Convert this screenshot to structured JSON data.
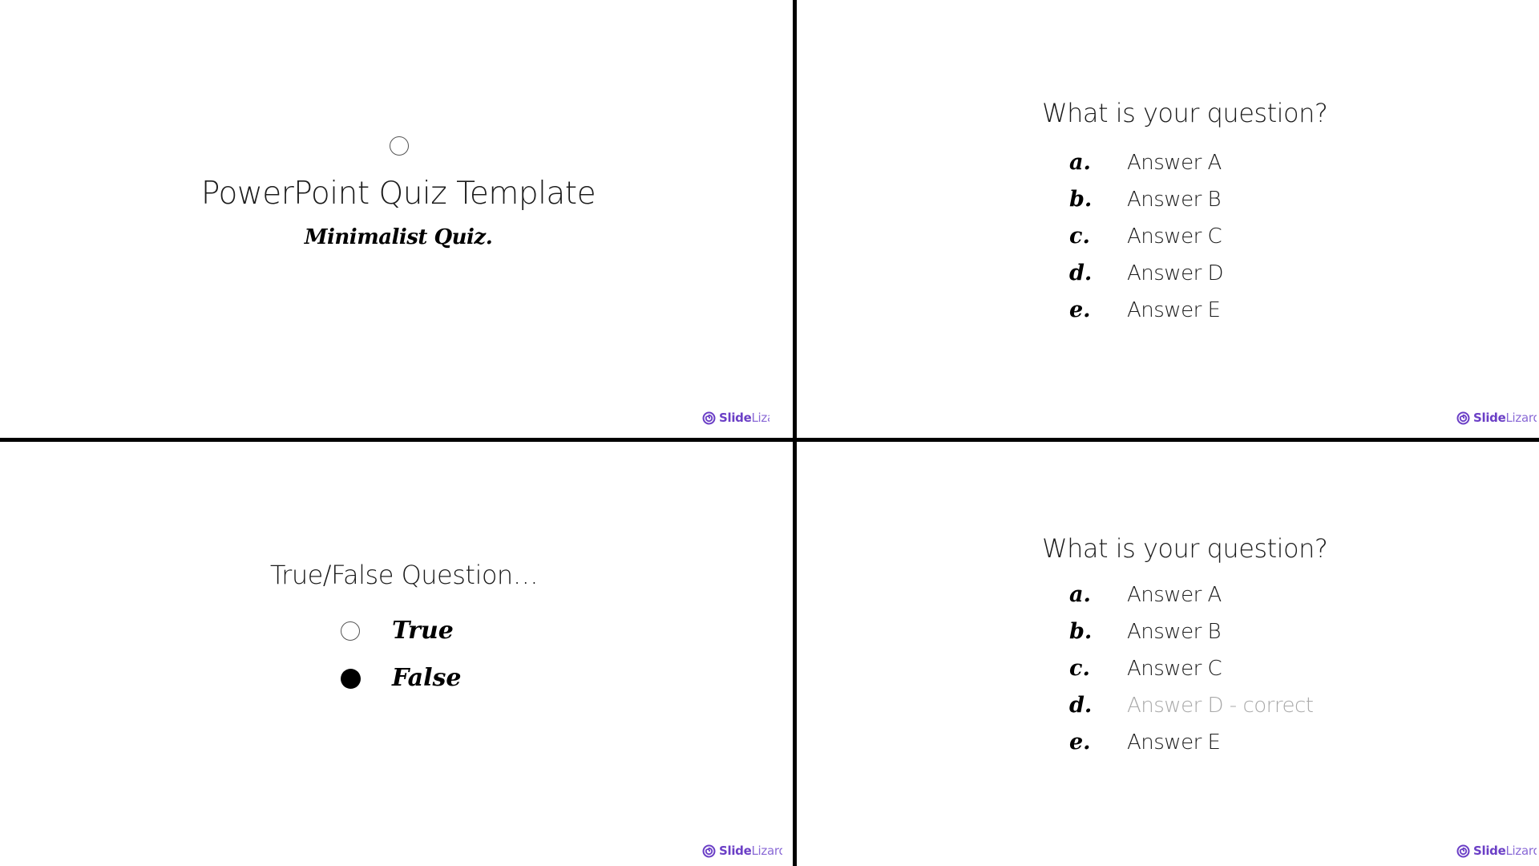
{
  "slides": {
    "title_slide": {
      "title": "PowerPoint Quiz Template",
      "subtitle": "Minimalist Quiz.",
      "icon": "radio-unselected-icon",
      "logo": {
        "word1": "Slide",
        "word2": "Lizard",
        "truncated": true
      }
    },
    "multiple_choice": {
      "question": "What is your question?",
      "answers": [
        {
          "letter": "a.",
          "text": "Answer A"
        },
        {
          "letter": "b.",
          "text": "Answer B"
        },
        {
          "letter": "c.",
          "text": "Answer C"
        },
        {
          "letter": "d.",
          "text": "Answer D"
        },
        {
          "letter": "e.",
          "text": "Answer E"
        }
      ],
      "logo": {
        "word1": "Slide",
        "word2": "Lizard"
      }
    },
    "true_false": {
      "question": "True/False Question…",
      "options": [
        {
          "label": "True",
          "selected": false
        },
        {
          "label": "False",
          "selected": true
        }
      ],
      "logo": {
        "word1": "Slide",
        "word2": "Lizard"
      }
    },
    "multiple_choice_answered": {
      "question": "What is your question?",
      "answers": [
        {
          "letter": "a.",
          "text": "Answer A",
          "correct": false
        },
        {
          "letter": "b.",
          "text": "Answer B",
          "correct": false
        },
        {
          "letter": "c.",
          "text": "Answer C",
          "correct": false
        },
        {
          "letter": "d.",
          "text": "Answer D - correct",
          "correct": true
        },
        {
          "letter": "e.",
          "text": "Answer E",
          "correct": false
        }
      ],
      "logo": {
        "word1": "Slide",
        "word2": "Lizard"
      }
    }
  },
  "colors": {
    "text": "#1c1c1c",
    "script": "#000000",
    "correct_answer": "#a9a9a9",
    "brand_primary": "#6b3fc6",
    "brand_secondary": "#8a6ad6",
    "divider": "#000000"
  }
}
